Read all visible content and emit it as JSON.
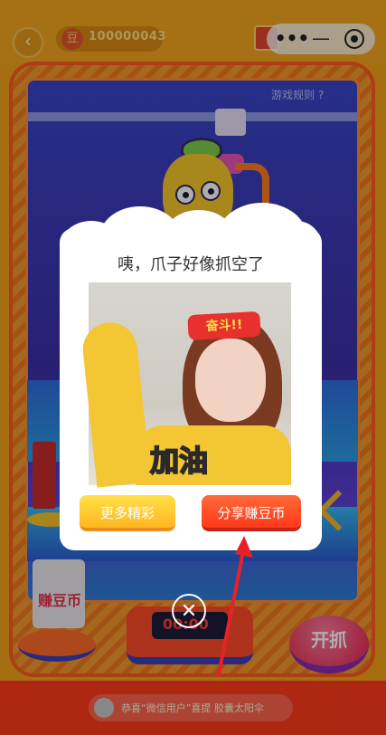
{
  "header": {
    "back_icon": "chevron-left-icon",
    "coins": "100000043",
    "gift_icon": "gift-icon",
    "capsule_more": "•••",
    "capsule_minimize": "—",
    "capsule_close_icon": "target-icon"
  },
  "machine": {
    "rules_label": "游戏规则 ?",
    "earn_label": "赚豆币",
    "screen_text": "00:00",
    "grab_label": "开抓",
    "notice": "恭喜“微信用户”喜提 胶囊太阳伞"
  },
  "dialog": {
    "title": "咦，爪子好像抓空了",
    "banner_text": "奋斗!!",
    "photo_caption": "加油",
    "more_label": "更多精彩",
    "share_label": "分享赚豆币",
    "close_icon": "close-icon"
  },
  "colors": {
    "accent_orange": "#f5a51e",
    "accent_red": "#ff3a1a",
    "glass_blue": "#3a45c9",
    "annotation_red": "#e8202a"
  }
}
